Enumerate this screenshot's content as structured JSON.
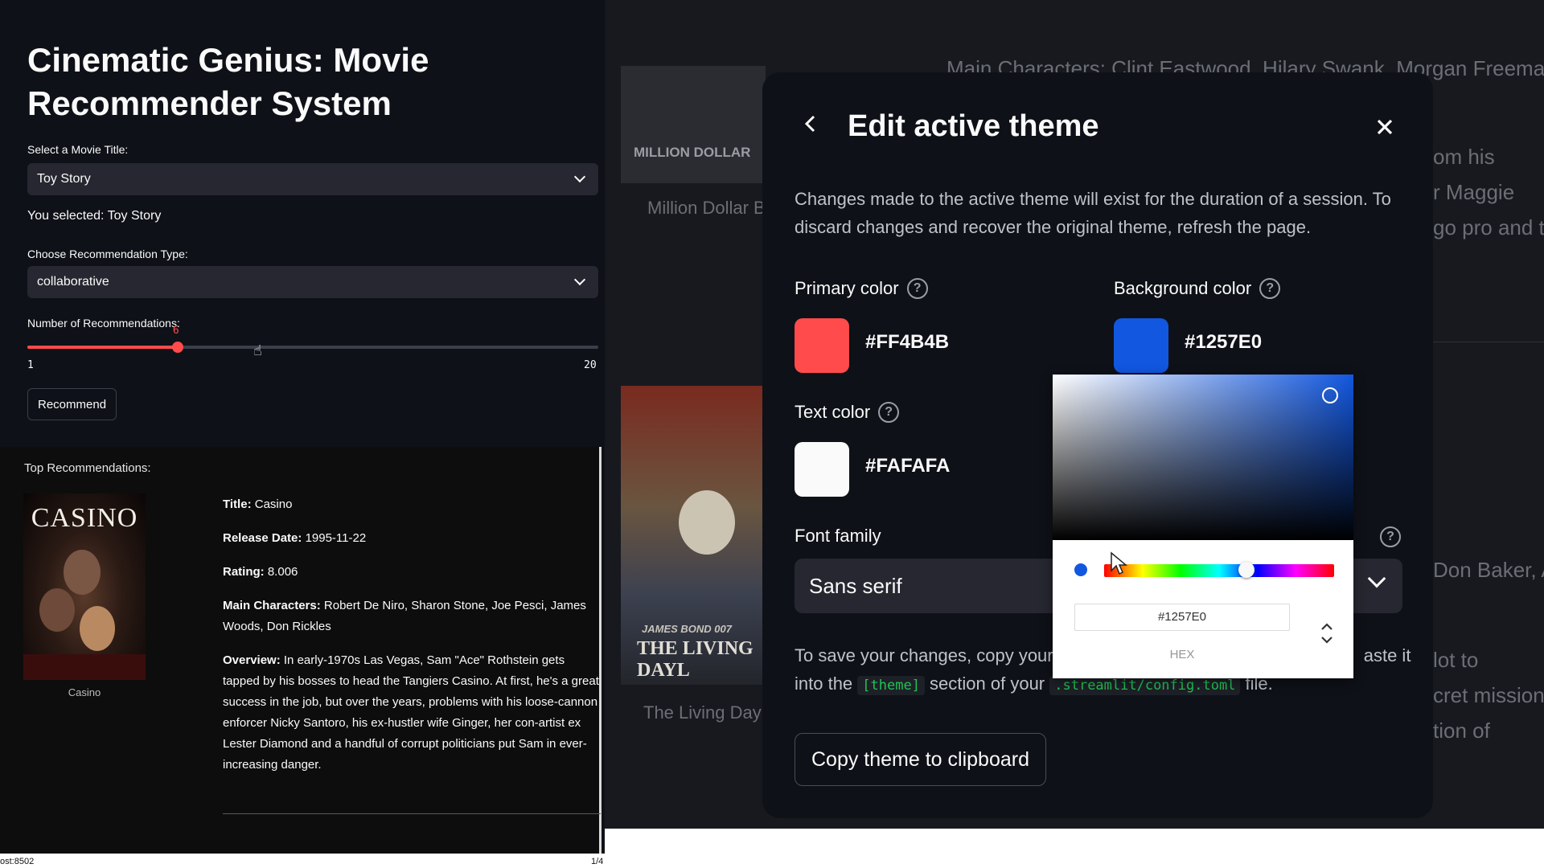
{
  "app": {
    "title": "Cinematic Genius: Movie Recommender System",
    "movie_select_label": "Select a Movie Title:",
    "movie_select_value": "Toy Story",
    "you_selected": "You selected: Toy Story",
    "rec_type_label": "Choose Recommendation Type:",
    "rec_type_value": "collaborative",
    "num_rec_label": "Number of Recommendations:",
    "slider": {
      "min": 1,
      "max": 20,
      "value": 6,
      "min_label": "1",
      "max_label": "20",
      "value_label": "6"
    },
    "recommend_button": "Recommend"
  },
  "results": {
    "heading": "Top Recommendations:",
    "poster_title": "CASINO",
    "poster_caption": "Casino",
    "title_label": "Title:",
    "title_value": "Casino",
    "release_label": "Release Date:",
    "release_value": "1995-11-22",
    "rating_label": "Rating:",
    "rating_value": "8.006",
    "characters_label": "Main Characters:",
    "characters_value": "Robert De Niro, Sharon Stone, Joe Pesci, James Woods, Don Rickles",
    "overview_label": "Overview:",
    "overview_value": "In early-1970s Las Vegas, Sam \"Ace\" Rothstein gets tapped by his bosses to head the Tangiers Casino. At first, he's a great success in the job, but over the years, problems with his loose-cannon enforcer Nicky Santoro, his ex-hustler wife Ginger, her con-artist ex Lester Diamond and a handful of corrupt politicians put Sam in ever-increasing danger."
  },
  "status": {
    "left": "ost:8502",
    "right": "1/4"
  },
  "background_page": {
    "top_text": "Main Characters: Clint Eastwood, Hilary Swank, Morgan Freeman,",
    "poster1_text": "MILLION DOLLAR",
    "caption1": "Million Dollar B",
    "r1": "om his",
    "r2": "r Maggie",
    "r3": "go pro and to",
    "poster2_brand": "JAMES BOND 007",
    "poster2_text": "THE LIVING DAYL",
    "caption2": "The Living Dayl",
    "r4": "Don Baker, Ar",
    "r5": "lot to",
    "r6": "cret mission t",
    "r7": "tion of"
  },
  "modal": {
    "title": "Edit active theme",
    "description": "Changes made to the active theme will exist for the duration of a session. To discard changes and recover the original theme, refresh the page.",
    "primary_label": "Primary color",
    "primary_hex": "#FF4B4B",
    "background_label": "Background color",
    "background_hex": "#1257E0",
    "text_label": "Text color",
    "text_hex": "#FAFAFA",
    "font_label": "Font family",
    "font_value": "Sans serif",
    "save_pre": "To save your changes, copy your ",
    "save_code1": "[theme]",
    "save_mid": " section of your ",
    "save_code2": ".streamlit/config.toml",
    "save_end": " file.",
    "save_line1_tail": "aste it",
    "save_line2_pre": "into the ",
    "copy_button": "Copy theme to clipboard"
  },
  "picker": {
    "hex_value": "#1257E0",
    "hex_label": "HEX",
    "hue_fraction": 0.62
  },
  "colors": {
    "primary": "#FF4B4B",
    "background": "#1257E0",
    "text": "#FAFAFA",
    "app_bg": "#0E1117"
  },
  "icons": {
    "back": "chevron-left-icon",
    "close": "close-icon",
    "help": "question-circle-icon",
    "dropdown": "chevron-down-icon",
    "toggle": "up-down-arrows-icon"
  }
}
